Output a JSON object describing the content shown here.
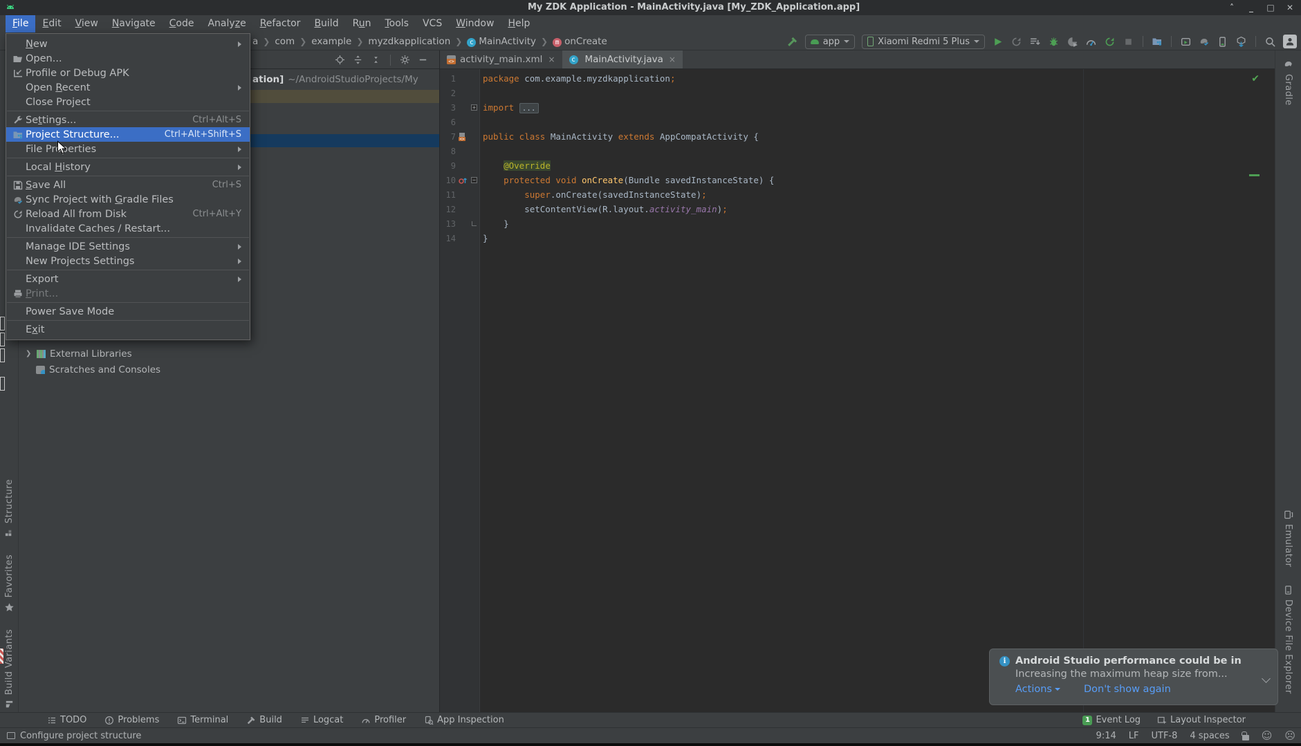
{
  "window": {
    "title": "My ZDK Application - MainActivity.java [My_ZDK_Application.app]",
    "controls": [
      "roll-up",
      "minimize",
      "maximize",
      "close"
    ]
  },
  "menubar": {
    "items": [
      {
        "label": "File",
        "u": 0,
        "active": true
      },
      {
        "label": "Edit",
        "u": 0
      },
      {
        "label": "View",
        "u": 0
      },
      {
        "label": "Navigate",
        "u": 0
      },
      {
        "label": "Code",
        "u": 0
      },
      {
        "label": "Analyze",
        "u": 5
      },
      {
        "label": "Refactor",
        "u": 0
      },
      {
        "label": "Build",
        "u": 0
      },
      {
        "label": "Run",
        "u": 1
      },
      {
        "label": "Tools",
        "u": 0
      },
      {
        "label": "VCS"
      },
      {
        "label": "Window",
        "u": 0
      },
      {
        "label": "Help",
        "u": 0
      }
    ]
  },
  "file_menu": {
    "items": [
      {
        "label": "New",
        "u": 0,
        "submenu": true
      },
      {
        "label": "Open...",
        "icon": "folder-open"
      },
      {
        "label": "Profile or Debug APK",
        "icon": "profile-apk"
      },
      {
        "label": "Open Recent",
        "u": 5,
        "submenu": true
      },
      {
        "label": "Close Project"
      },
      {
        "sep": true
      },
      {
        "label": "Settings...",
        "u": 2,
        "icon": "wrench",
        "shortcut": "Ctrl+Alt+S"
      },
      {
        "label": "Project Structure...",
        "icon": "project-structure",
        "shortcut": "Ctrl+Alt+Shift+S",
        "selected": true
      },
      {
        "label": "File Properties",
        "submenu": true
      },
      {
        "sep": true
      },
      {
        "label": "Local History",
        "u": 6,
        "submenu": true
      },
      {
        "sep": true
      },
      {
        "label": "Save All",
        "u": 0,
        "icon": "save",
        "shortcut": "Ctrl+S"
      },
      {
        "label": "Sync Project with Gradle Files",
        "u": 18,
        "icon": "gradle-sync"
      },
      {
        "label": "Reload All from Disk",
        "icon": "reload",
        "shortcut": "Ctrl+Alt+Y"
      },
      {
        "label": "Invalidate Caches / Restart..."
      },
      {
        "sep": true
      },
      {
        "label": "Manage IDE Settings",
        "submenu": true
      },
      {
        "label": "New Projects Settings",
        "submenu": true
      },
      {
        "sep": true
      },
      {
        "label": "Export",
        "submenu": true
      },
      {
        "label": "Print...",
        "u": 0,
        "icon": "print",
        "disabled": true
      },
      {
        "sep": true
      },
      {
        "label": "Power Save Mode"
      },
      {
        "sep": true
      },
      {
        "label": "Exit",
        "u": 1
      }
    ]
  },
  "breadcrumb": {
    "items": [
      {
        "label": "a"
      },
      {
        "label": "com"
      },
      {
        "label": "example"
      },
      {
        "label": "myzdkapplication"
      },
      {
        "label": "MainActivity",
        "icon": "class"
      },
      {
        "label": "onCreate",
        "icon": "method"
      }
    ]
  },
  "toolbar": {
    "run_config": "app",
    "device": "Xiaomi Redmi 5 Plus",
    "icons": [
      "build-hammer",
      "run",
      "rerun",
      "apply-changes",
      "debug",
      "attach-profiler",
      "profiler",
      "apply-code-changes",
      "stop",
      "project-structure",
      "run-window",
      "gradle-sync",
      "device-manager",
      "sdk-manager",
      "search",
      "avatar"
    ]
  },
  "project_panel": {
    "root_name_clipped": "ation]",
    "root_path": "~/AndroidStudioProjects/My",
    "tree": [
      {
        "label": "External Libraries"
      },
      {
        "label": "Scratches and Consoles"
      }
    ]
  },
  "tabs": [
    {
      "label": "activity_main.xml",
      "icon": "xml",
      "close": "×"
    },
    {
      "label": "MainActivity.java",
      "icon": "class",
      "close": "×",
      "active": true
    }
  ],
  "editor": {
    "lines": [
      {
        "n": "1",
        "t": [
          [
            "k",
            "package "
          ],
          [
            "p",
            "com.example.myzdkapplication"
          ],
          [
            "s",
            ";"
          ]
        ]
      },
      {
        "n": "2",
        "t": []
      },
      {
        "n": "3",
        "t": [
          [
            "k",
            "import "
          ],
          [
            "fold",
            "..."
          ]
        ],
        "fold": "plus"
      },
      {
        "n": "6",
        "t": []
      },
      {
        "n": "7",
        "t": [
          [
            "k",
            "public class "
          ],
          [
            "p",
            "MainActivity "
          ],
          [
            "k",
            "extends "
          ],
          [
            "p",
            "AppCompatActivity {"
          ]
        ],
        "gicon": "layout"
      },
      {
        "n": "8",
        "t": []
      },
      {
        "n": "9",
        "t": [
          [
            "p",
            "    "
          ],
          [
            "a",
            "@Override"
          ]
        ],
        "bulb": true
      },
      {
        "n": "10",
        "t": [
          [
            "p",
            "    "
          ],
          [
            "k",
            "protected void "
          ],
          [
            "d",
            "onCreate"
          ],
          [
            "p",
            "(Bundle savedInstanceState) {"
          ]
        ],
        "gicon": "override",
        "fold": "minus"
      },
      {
        "n": "11",
        "t": [
          [
            "p",
            "        "
          ],
          [
            "k",
            "super"
          ],
          [
            "p",
            ".onCreate(savedInstanceState)"
          ],
          [
            "s",
            ";"
          ]
        ]
      },
      {
        "n": "12",
        "t": [
          [
            "p",
            "        setContentView(R.layout."
          ],
          [
            "f",
            "activity_main"
          ],
          [
            "p",
            ")"
          ],
          [
            "s",
            ";"
          ]
        ]
      },
      {
        "n": "13",
        "t": [
          [
            "p",
            "    }"
          ]
        ],
        "fold": "end"
      },
      {
        "n": "14",
        "t": [
          [
            "p",
            "}"
          ]
        ]
      }
    ]
  },
  "left_stripe": [
    {
      "label": "Structure",
      "icon": "structure"
    },
    {
      "label": "Favorites",
      "icon": "favorites"
    },
    {
      "label": "Build Variants",
      "icon": "build-variants"
    }
  ],
  "right_stripe": {
    "top": [
      {
        "label": "Gradle",
        "icon": "gradle"
      }
    ],
    "bottom": [
      {
        "label": "Emulator",
        "icon": "emulator"
      },
      {
        "label": "Device File Explorer",
        "icon": "device-file-explorer"
      }
    ]
  },
  "bottom_bar": {
    "left": [
      {
        "label": "TODO",
        "icon": "todo"
      },
      {
        "label": "Problems",
        "icon": "problems"
      },
      {
        "label": "Terminal",
        "icon": "terminal"
      },
      {
        "label": "Build",
        "icon": "build"
      },
      {
        "label": "Logcat",
        "icon": "logcat"
      },
      {
        "label": "Profiler",
        "icon": "profiler-small"
      },
      {
        "label": "App Inspection",
        "icon": "app-inspection"
      }
    ],
    "right": [
      {
        "label": "Event Log",
        "icon": "event-log",
        "badge": "1"
      },
      {
        "label": "Layout Inspector",
        "icon": "layout-inspector"
      }
    ]
  },
  "status_bar": {
    "message": "Configure project structure",
    "caret_position": "9:14",
    "line_ending": "LF",
    "encoding": "UTF-8",
    "indent": "4 spaces",
    "faces": [
      "happy",
      "sad"
    ]
  },
  "notification": {
    "title": "Android Studio performance could be in",
    "body": "Increasing the maximum heap size from...",
    "actions_label": "Actions",
    "dismiss_label": "Don't show again"
  },
  "colors": {
    "accent_selection": "#3b6ec5",
    "editor_bg": "#2b2b2b",
    "panel_bg": "#3c3f41",
    "tree_selected": "#153a5e",
    "tree_hover": "#514d3c",
    "keyword": "#CC7832",
    "annotation": "#BBB529",
    "method_decl": "#FFC66D",
    "field_ref": "#9876AA",
    "run_green": "#4D9E54",
    "link_blue": "#589DF6"
  }
}
